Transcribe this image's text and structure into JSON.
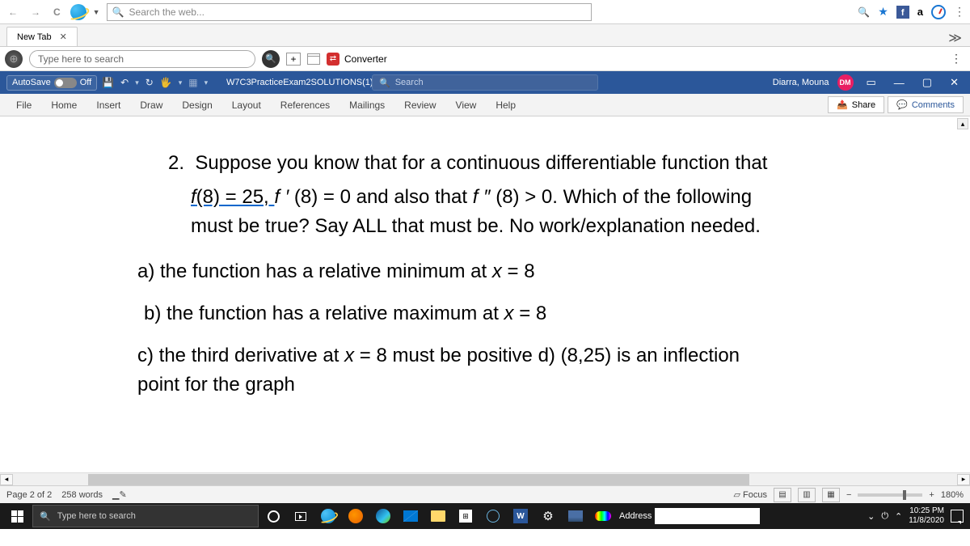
{
  "browser": {
    "search_placeholder": "Search the web...",
    "tab_label": "New Tab",
    "toolbar2_placeholder": "Type here to search",
    "converter_label": "Converter"
  },
  "word": {
    "autosave_label": "AutoSave",
    "autosave_state": "Off",
    "doc_title": "W7C3PracticeExam2SOLUTIONS(1) - Word",
    "search_placeholder": "Search",
    "user_name": "Diarra, Mouna",
    "user_initials": "DM",
    "ribbon_tabs": [
      "File",
      "Home",
      "Insert",
      "Draw",
      "Design",
      "Layout",
      "References",
      "Mailings",
      "Review",
      "View",
      "Help"
    ],
    "share_label": "Share",
    "comments_label": "Comments",
    "status_page": "Page 2 of 2",
    "status_words": "258 words",
    "focus_label": "Focus",
    "zoom_label": "180%"
  },
  "document": {
    "q_number": "2.",
    "line1a": "Suppose you know that for a continuous differentiable function that",
    "line2a": "f",
    "line2b": "(8) = 25, ",
    "line2c": "f ′ ",
    "line2d": "(8) = 0 and also that ",
    "line2e": "f ″ ",
    "line2f": "(8) > 0. Which of the following",
    "line3": "must be true? Say ALL that must be. No work/explanation needed.",
    "opt_a": "a) the function has a relative minimum at ",
    "opt_a_x": "x",
    "opt_a_end": " = 8",
    "opt_b": "b) the function has a relative maximum at ",
    "opt_b_x": "x",
    "opt_b_end": " = 8",
    "opt_c1": "c) the third derivative at ",
    "opt_c_x": "x",
    "opt_c2": " = 8 must be positive d) (8,25) is an inflection",
    "opt_c3": "point for the graph"
  },
  "taskbar": {
    "search_placeholder": "Type here to search",
    "address_label": "Address",
    "time": "10:25 PM",
    "date": "11/8/2020"
  }
}
